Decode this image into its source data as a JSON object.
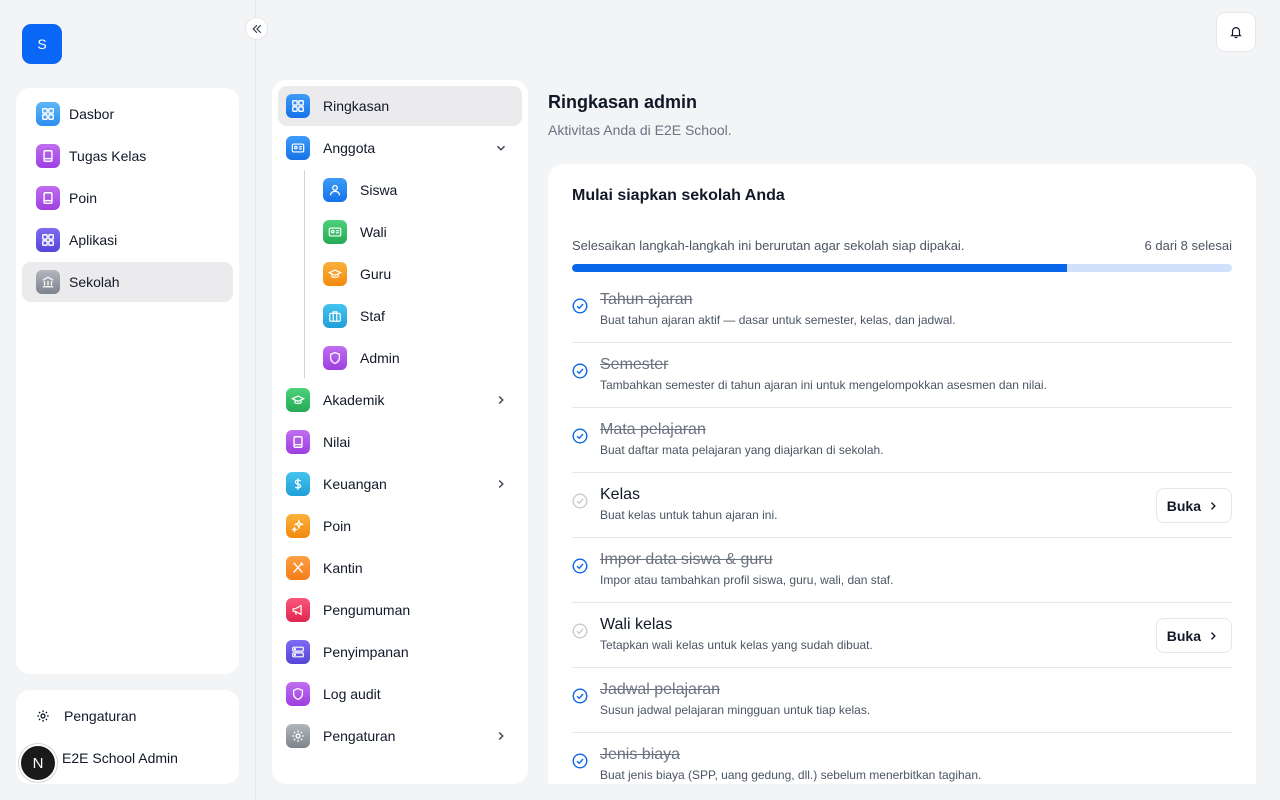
{
  "app": {
    "logo_letter": "S"
  },
  "sidebar": {
    "items": [
      {
        "label": "Dasbor",
        "icon": "dashboard-icon"
      },
      {
        "label": "Tugas Kelas",
        "icon": "book-icon"
      },
      {
        "label": "Poin",
        "icon": "book-icon"
      },
      {
        "label": "Aplikasi",
        "icon": "grid-icon"
      },
      {
        "label": "Sekolah",
        "icon": "building-icon"
      }
    ],
    "settings_label": "Pengaturan",
    "user": {
      "initial": "N",
      "name": "E2E School Admin"
    }
  },
  "subnav": {
    "items": [
      {
        "label": "Ringkasan"
      },
      {
        "label": "Anggota"
      },
      {
        "label": "Akademik"
      },
      {
        "label": "Nilai"
      },
      {
        "label": "Keuangan"
      },
      {
        "label": "Poin"
      },
      {
        "label": "Kantin"
      },
      {
        "label": "Pengumuman"
      },
      {
        "label": "Penyimpanan"
      },
      {
        "label": "Log audit"
      },
      {
        "label": "Pengaturan"
      }
    ],
    "members": [
      {
        "label": "Siswa"
      },
      {
        "label": "Wali"
      },
      {
        "label": "Guru"
      },
      {
        "label": "Staf"
      },
      {
        "label": "Admin"
      }
    ]
  },
  "main": {
    "title": "Ringkasan admin",
    "subtitle": "Aktivitas Anda di E2E School.",
    "setup": {
      "title": "Mulai siapkan sekolah Anda",
      "progress_text": "Selesaikan langkah-langkah ini berurutan agar sekolah siap dipakai.",
      "progress_count": "6 dari 8 selesai",
      "progress_fraction": 0.75,
      "open_label": "Buka",
      "steps": [
        {
          "name": "Tahun ajaran",
          "desc": "Buat tahun ajaran aktif — dasar untuk semester, kelas, dan jadwal.",
          "done": true
        },
        {
          "name": "Semester",
          "desc": "Tambahkan semester di tahun ajaran ini untuk mengelompokkan asesmen dan nilai.",
          "done": true
        },
        {
          "name": "Mata pelajaran",
          "desc": "Buat daftar mata pelajaran yang diajarkan di sekolah.",
          "done": true
        },
        {
          "name": "Kelas",
          "desc": "Buat kelas untuk tahun ajaran ini.",
          "done": false
        },
        {
          "name": "Impor data siswa & guru",
          "desc": "Impor atau tambahkan profil siswa, guru, wali, dan staf.",
          "done": true
        },
        {
          "name": "Wali kelas",
          "desc": "Tetapkan wali kelas untuk kelas yang sudah dibuat.",
          "done": false
        },
        {
          "name": "Jadwal pelajaran",
          "desc": "Susun jadwal pelajaran mingguan untuk tiap kelas.",
          "done": true
        },
        {
          "name": "Jenis biaya",
          "desc": "Buat jenis biaya (SPP, uang gedung, dll.) sebelum menerbitkan tagihan.",
          "done": true
        }
      ]
    }
  }
}
